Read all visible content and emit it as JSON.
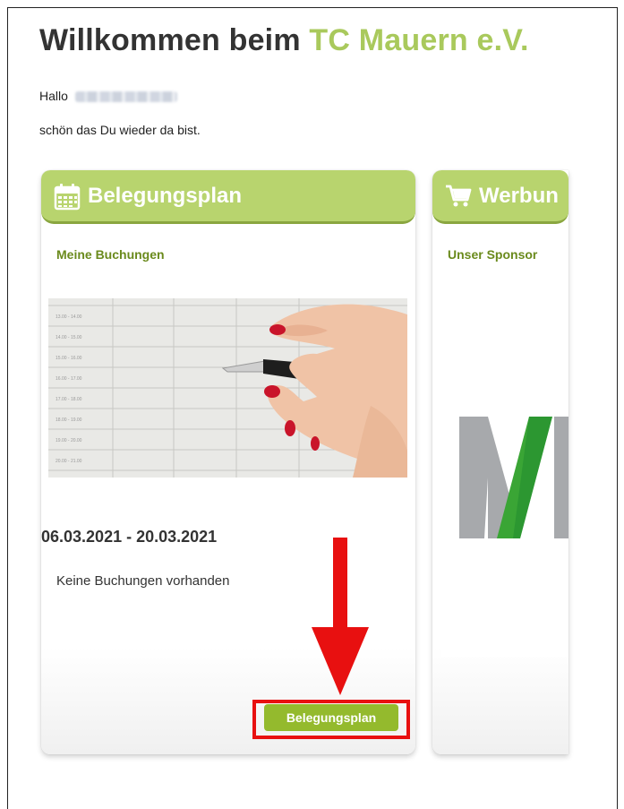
{
  "header": {
    "title_prefix": "Willkommen beim ",
    "club_name": "TC Mauern e.V.",
    "greeting": "Hallo",
    "welcome_back": "schön das Du wieder da bist."
  },
  "cards": {
    "booking": {
      "title": "Belegungsplan",
      "subtitle": "Meine Buchungen",
      "date_range": "06.03.2021 - 20.03.2021",
      "empty_text": "Keine Buchungen vorhanden",
      "button_label": "Belegungsplan",
      "icon": "calendar-icon"
    },
    "advertising": {
      "title": "Werbun",
      "subtitle": "Unser Sponsor",
      "icon": "shopping-cart-icon"
    }
  },
  "schedule_image": {
    "time_labels": [
      "13.00 - 14.00",
      "14.00 - 15.00",
      "15.00 - 16.00",
      "16.00 - 17.00",
      "17.00 - 18.00",
      "18.00 - 19.00",
      "19.00 - 20.00",
      "20.00 - 21.00"
    ]
  },
  "colors": {
    "accent_green": "#b8d46e",
    "club_green": "#a9c95c",
    "button_green": "#94ba2d",
    "annotation_red": "#e81010"
  }
}
